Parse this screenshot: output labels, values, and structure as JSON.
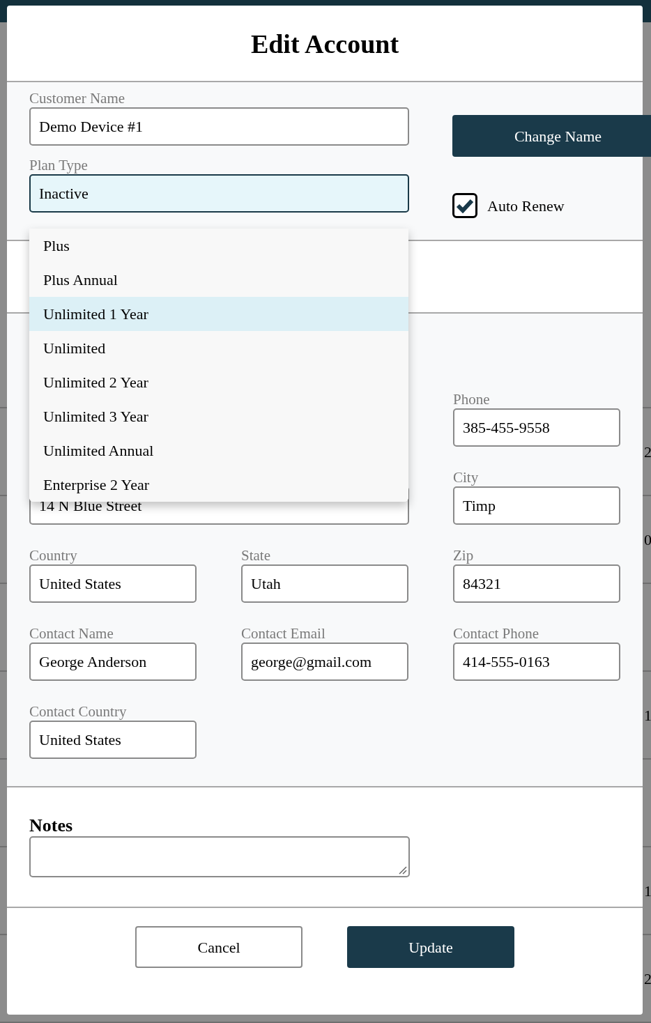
{
  "background": {
    "edge_texts": [
      "2",
      "0",
      "1",
      "1",
      "2"
    ]
  },
  "dialog": {
    "title": "Edit Account",
    "customer_name": {
      "label": "Customer Name",
      "value": "Demo Device #1"
    },
    "change_name_button": "Change Name",
    "plan_type": {
      "label": "Plan Type",
      "value": "Inactive",
      "expanded": true,
      "options": [
        {
          "label": "Plus",
          "selected": false
        },
        {
          "label": "Plus Annual",
          "selected": false
        },
        {
          "label": "Unlimited 1 Year",
          "selected": true
        },
        {
          "label": "Unlimited",
          "selected": false
        },
        {
          "label": "Unlimited 2 Year",
          "selected": false
        },
        {
          "label": "Unlimited 3 Year",
          "selected": false
        },
        {
          "label": "Unlimited Annual",
          "selected": false
        },
        {
          "label": "Enterprise 2 Year",
          "selected": false
        }
      ]
    },
    "auto_renew": {
      "label": "Auto Renew",
      "checked": true
    },
    "phone": {
      "label": "Phone",
      "value": "385-455-9558"
    },
    "address": {
      "value": "14 N Blue Street"
    },
    "city": {
      "label": "City",
      "value": "Timp"
    },
    "country": {
      "label": "Country",
      "value": "United States"
    },
    "state": {
      "label": "State",
      "value": "Utah"
    },
    "zip": {
      "label": "Zip",
      "value": "84321"
    },
    "contact_name": {
      "label": "Contact Name",
      "value": "George Anderson"
    },
    "contact_email": {
      "label": "Contact Email",
      "value": "george@gmail.com"
    },
    "contact_phone": {
      "label": "Contact Phone",
      "value": "414-555-0163"
    },
    "contact_country": {
      "label": "Contact Country",
      "value": "United States"
    },
    "notes": {
      "label": "Notes"
    },
    "buttons": [
      "Cancel",
      "Update"
    ]
  }
}
